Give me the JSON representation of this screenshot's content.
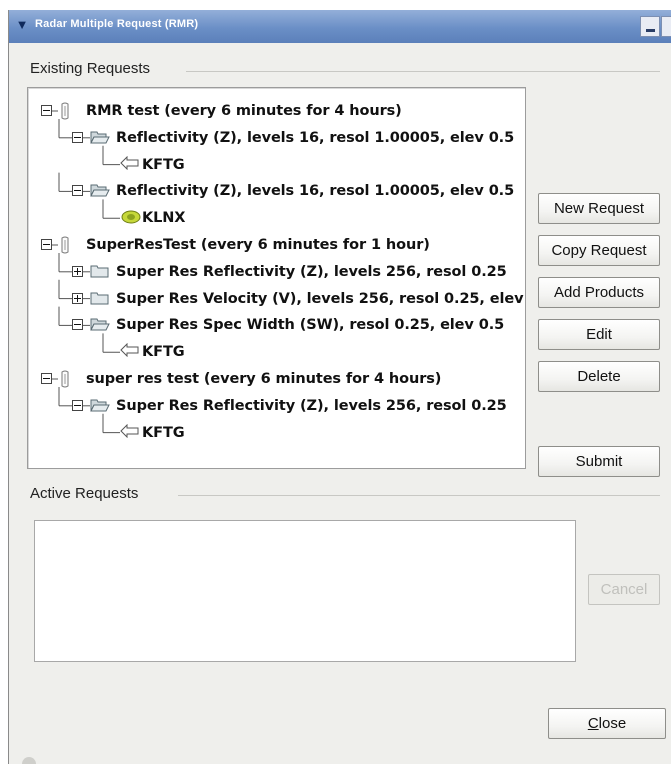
{
  "window": {
    "title": "Radar Multiple Request (RMR)"
  },
  "existing_requests": {
    "label": "Existing Requests",
    "tree": [
      {
        "level": 0,
        "expander": "expanded",
        "icon": "request-icon",
        "text": "RMR test (every 6 minutes for 4 hours)"
      },
      {
        "level": 1,
        "expander": "expanded",
        "icon": "folder-open-icon",
        "text": "Reflectivity (Z), levels 16, resol 1.00005, elev 0.5"
      },
      {
        "level": 2,
        "expander": "none",
        "icon": "arrow-left-icon",
        "text": "KFTG"
      },
      {
        "level": 1,
        "expander": "expanded",
        "icon": "folder-open-icon",
        "text": "Reflectivity (Z), levels 16, resol 1.00005, elev 0.5"
      },
      {
        "level": 2,
        "expander": "none",
        "icon": "radar-site-icon",
        "text": "KLNX"
      },
      {
        "level": 0,
        "expander": "expanded",
        "icon": "request-icon",
        "text": "SuperResTest (every 6 minutes for 1 hour)"
      },
      {
        "level": 1,
        "expander": "collapsed",
        "icon": "folder-closed-icon",
        "text": "Super Res Reflectivity (Z), levels 256, resol 0.25"
      },
      {
        "level": 1,
        "expander": "collapsed",
        "icon": "folder-closed-icon",
        "text": "Super Res Velocity (V), levels 256, resol 0.25, elev"
      },
      {
        "level": 1,
        "expander": "expanded",
        "icon": "folder-open-icon",
        "text": "Super Res Spec Width (SW), resol 0.25, elev 0.5"
      },
      {
        "level": 2,
        "expander": "none",
        "icon": "arrow-left-icon",
        "text": "KFTG"
      },
      {
        "level": 0,
        "expander": "expanded",
        "icon": "request-icon",
        "text": "super res test (every 6 minutes for 4 hours)"
      },
      {
        "level": 1,
        "expander": "expanded",
        "icon": "folder-open-icon",
        "text": "Super Res Reflectivity (Z), levels 256, resol 0.25"
      },
      {
        "level": 2,
        "expander": "none",
        "icon": "arrow-left-icon",
        "text": "KFTG"
      }
    ]
  },
  "buttons": {
    "new_request": "New Request",
    "copy_request": "Copy Request",
    "add_products": "Add Products",
    "edit": "Edit",
    "delete": "Delete",
    "submit": "Submit",
    "cancel": "Cancel",
    "close": "Close"
  },
  "active_requests": {
    "label": "Active Requests",
    "items": []
  },
  "colors": {
    "titlebar": "#6b8fc6",
    "window_bg": "#efefec",
    "disabled_text": "#c0c0bc"
  }
}
